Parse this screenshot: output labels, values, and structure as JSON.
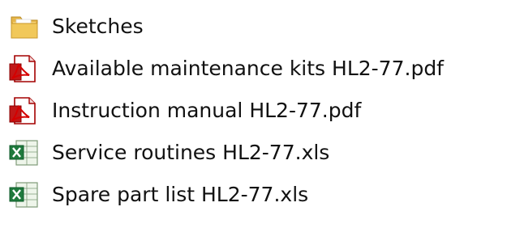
{
  "files": [
    {
      "name": "Sketches",
      "icon": "folder-icon"
    },
    {
      "name": "Available maintenance kits HL2-77.pdf",
      "icon": "pdf-icon"
    },
    {
      "name": "Instruction manual HL2-77.pdf",
      "icon": "pdf-icon"
    },
    {
      "name": "Service routines HL2-77.xls",
      "icon": "excel-icon"
    },
    {
      "name": "Spare part list HL2-77.xls",
      "icon": "excel-icon"
    }
  ]
}
